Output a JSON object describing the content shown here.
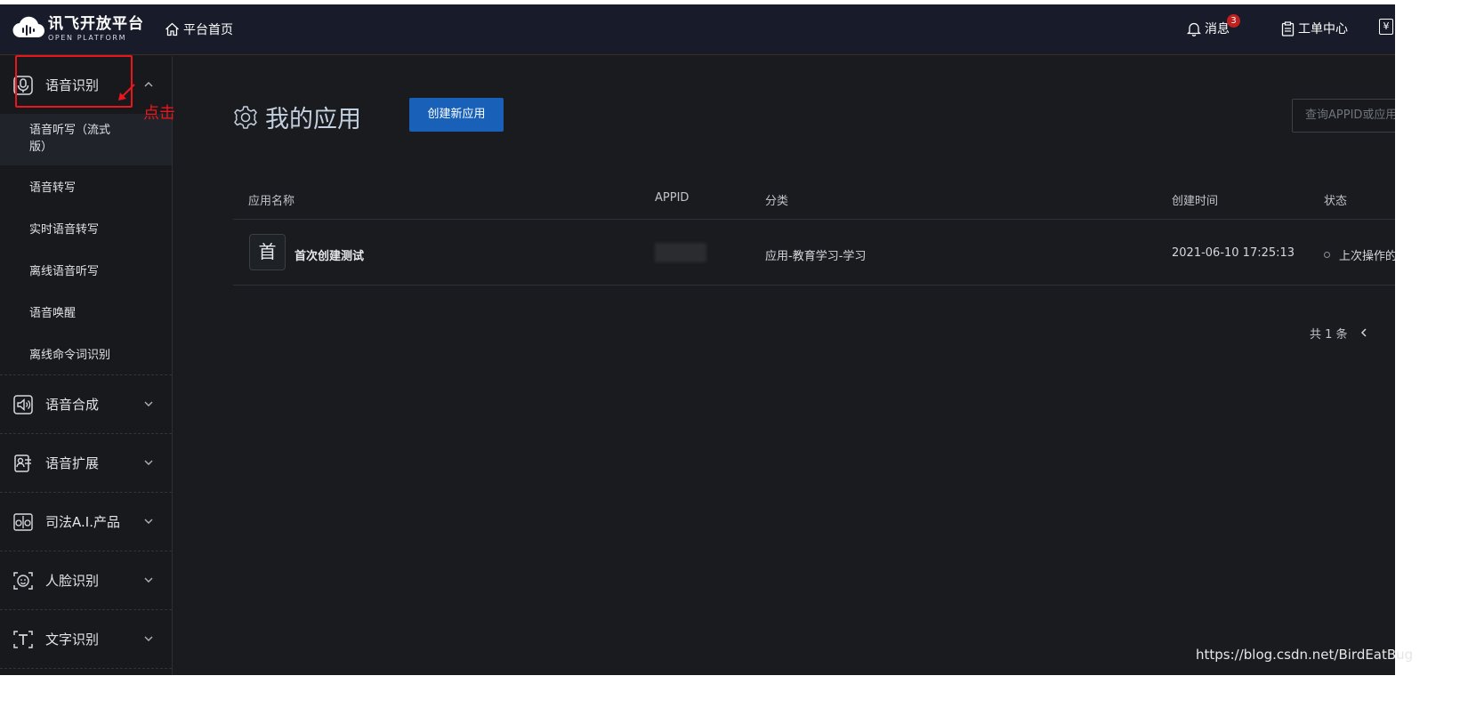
{
  "header": {
    "logo_main": "讯飞开放平台",
    "logo_sub": "OPEN PLATFORM",
    "home": "平台首页",
    "messages": "消息",
    "message_count": "3",
    "tickets": "工单中心",
    "currency_icon": "¥"
  },
  "sidebar": {
    "groups": [
      {
        "label": "语音识别",
        "icon": "microphone-icon",
        "expanded": true,
        "items": [
          "语音听写（流式版）",
          "语音转写",
          "实时语音转写",
          "离线语音听写",
          "语音唤醒",
          "离线命令词识别"
        ]
      },
      {
        "label": "语音合成",
        "icon": "speaker-icon"
      },
      {
        "label": "语音扩展",
        "icon": "voice-ext-icon"
      },
      {
        "label": "司法A.I.产品",
        "icon": "scale-icon"
      },
      {
        "label": "人脸识别",
        "icon": "face-icon"
      },
      {
        "label": "文字识别",
        "icon": "text-icon"
      }
    ]
  },
  "annotation": {
    "text": "点击",
    "color": "#e8161d"
  },
  "main": {
    "title": "我的应用",
    "create_button": "创建新应用",
    "search_placeholder": "查询APPID或应用",
    "table": {
      "columns": [
        "应用名称",
        "APPID",
        "分类",
        "创建时间",
        "状态"
      ],
      "rows": [
        {
          "icon_char": "首",
          "name": "首次创建测试",
          "appid": "",
          "category": "应用-教育学习-学习",
          "created": "2021-06-10 17:25:13",
          "status": "上次操作的"
        }
      ]
    },
    "pagination": {
      "total": "共 1 条"
    }
  },
  "watermark": "https://blog.csdn.net/BirdEatBug",
  "colors": {
    "primary": "#1961b8",
    "background": "#191b1f",
    "header": "#181b29",
    "badge": "#c0201e"
  }
}
